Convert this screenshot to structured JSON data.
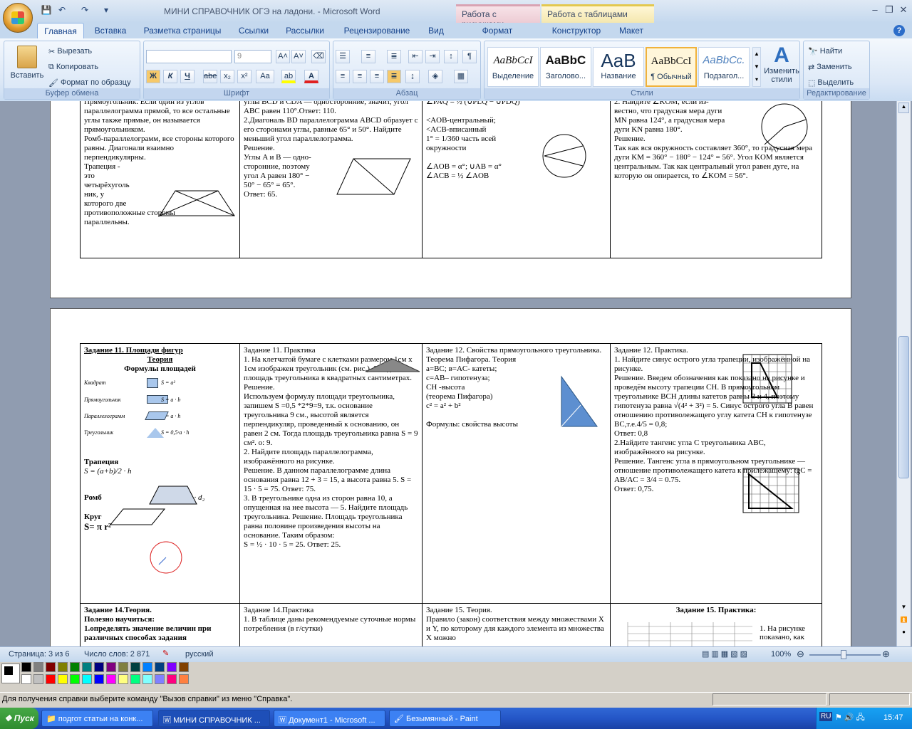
{
  "window": {
    "title": "МИНИ СПРАВОЧНИК ОГЭ на ладони. - Microsoft Word",
    "ctx_tab1": "Работа с рисунками",
    "ctx_tab2": "Работа с таблицами"
  },
  "tabs": [
    "Главная",
    "Вставка",
    "Разметка страницы",
    "Ссылки",
    "Рассылки",
    "Рецензирование",
    "Вид",
    "Формат",
    "Конструктор",
    "Макет"
  ],
  "clipboard": {
    "paste": "Вставить",
    "cut": "Вырезать",
    "copy": "Копировать",
    "format": "Формат по образцу",
    "label": "Буфер обмена"
  },
  "font": {
    "name": "",
    "size": "9",
    "label": "Шрифт",
    "b": "Ж",
    "i": "К",
    "u": "Ч",
    "strike": "abe",
    "sub": "x₂",
    "sup": "x²",
    "case": "Aa"
  },
  "paragraph": {
    "label": "Абзац"
  },
  "styles": {
    "label": "Стили",
    "change": "Изменить стили",
    "items": [
      {
        "sample": "AaBbCcI",
        "name": "Выделение"
      },
      {
        "sample": "AaBbC",
        "name": "Заголово..."
      },
      {
        "sample": "AaB",
        "name": "Название"
      },
      {
        "sample": "AaBbCcI",
        "name": "¶ Обычный"
      },
      {
        "sample": "AaBbCc.",
        "name": "Подзагол..."
      }
    ]
  },
  "editing": {
    "find": "Найти",
    "replace": "Заменить",
    "select": "Выделить",
    "label": "Редактирование"
  },
  "doc": {
    "p1": {
      "c1": "Прямоугольник. Если один из углов параллелограмма прямой, то все остальные углы также прямые, он называется прямоугольником.\nРомб-параллелограмм, все стороны которого равны. Диагонали взаимно перпендикулярны.\nТрапеция -\nэто\nчетырёхуголь\nник, у\nкоторого две\nпротивоположные стороны\nпараллельны.",
      "c2": "углы BCD и CDA — односторонние, значит, угол ABC равен 110°.Ответ: 110.\n2.Диагональ BD параллелограмма ABCD образует с его сторонами углы, равные 65° и 50°. Найдите меньший угол параллелограмма.\nРешение.\nУглы A и B — одно-\nсторонние, поэтому\nугол A равен 180° −\n50° − 65° = 65°.\nОтвет: 65.",
      "c3": "∠PAQ = ½ (∪PLQ − ∪PDQ)\n\n<AOB-центральный;\n<ACB-вписанный\n1° = 1/360 часть всей\nокружности\n\n∠AOB = α°; ∪AB = α°\n∠ACB = ½ ∠AOB",
      "c4": "2. Найдите ∠KOM, если из-\nвестно, что градусная мера дуги\nMN равна 124°, а градусная мера\nдуги KN равна 180°.\nРешение.\nТак как вся окружность составляет 360°, то градусная мера дуги KM = 360° − 180° − 124° = 56°. Угол KOM является центральным. Так как центральный угол равен дуге, на которую он опирается, то ∠KOM = 56°."
    },
    "p2": {
      "r1c1_head": "Задание 11. Площади фигур",
      "r1c1_sub": "Теория",
      "r1c1_sub2": "Формулы площадей",
      "shapes": [
        {
          "name": "Квадрат",
          "f": "S = a²"
        },
        {
          "name": "Прямоугольник",
          "f": "S = a · b"
        },
        {
          "name": "Параллелограмм",
          "f": "S = a · h"
        },
        {
          "name": "Треугольник",
          "f": "S = 0,5·a · h"
        }
      ],
      "trap": "Трапеция",
      "trap_f": "S = (a+b)/2 · h",
      "rhomb": "Ромб",
      "rhomb_f": "S = ½ · d₁ · d₂",
      "circle": "Круг",
      "circle_f": "S= π r²",
      "r1c2": "Задание 11. Практика\n1. На клетчатой бумаге с клетками размером 1см х 1см изображен треугольник (см. рис.). Найдите площадь треугольника в квадратных сантиметрах. Решение.\nИспользуем формулу площади треугольника, запишем S =0,5 *2*9=9, т.к. основание треугольника 9 см., высотой является перпендикуляр, проведенный к основанию, он равен 2 см. Тогда площадь треугольника равна S = 9 см². о: 9.\n2. Найдите площадь параллелограмма, изображённого на рисунке.\nРешение. В данном параллелограмме длина основания равна 12 + 3 = 15, а высота равна 5. S = 15 · 5 = 75. Ответ: 75.\n3. В треугольнике одна из сторон равна 10, а опущенная на нее высота — 5. Найдите площадь треугольника. Решение. Площадь треугольника равна половине произведения высоты на основание. Таким образом:\nS = ½ · 10 · 5 = 25. Ответ: 25.",
      "r1c3": "Задание 12. Свойства прямоугольного треугольника. Теорема Пифагора. Теория\na=BC; в=AC- катеты;\nc=AB– гипотенуза;\nCH -высота\n(теорема Пифагора)\nc² = a² + b²\n\nФормулы:          свойства высоты",
      "r1c4": "Задание 12. Практика.\n1. Найдите синус острого угла трапеции, изображённой на рисунке.\nРешение. Введем обозначения как показано на рисунке и проведём высоту трапеции CH. В прямоугольном треугольнике BCH длины катетов равны 3 и 4, поэтому гипотенуза равна √(4² + 3²) = 5. Синус острого угла B равен отношению противолежащего углу катета CH к гипотенузе BC,т.е.4/5 = 0,8;\nОтвет: 0,8\n2.Найдите тангенс угла C треугольника ABC, изображённого на рисунке.\nРешение. Тангенс угла в прямоугольном треугольнике — отношение противолежащего катета к прилежащему: tgC = AB/AC = 3/4 = 0.75.\nОтвет: 0,75.",
      "r2c1": "Задание 14.Теория.\nПолезно научиться:\n1.определять значение величин при различных способах задания",
      "r2c2": "Задание 14.Практика\n1. В таблице даны рекомендуемые суточные нормы потребления (в г/сутки)",
      "r2c3": "Задание 15. Теория.\nПравило (закон) соответствия между множествами X и Y, по которому для каждого элемента из множества X можно",
      "r2c4": "Задание 15. Практика:",
      "r2c4b": "1. На рисунке показано, как"
    }
  },
  "status": {
    "page": "Страница: 3 из 6",
    "words": "Число слов: 2 871",
    "lang": "русский",
    "zoom": "100%"
  },
  "paint": {
    "help": "Для получения справки выберите команду \"Вызов справки\" из меню \"Справка\".",
    "colors": [
      "#000000",
      "#808080",
      "#800000",
      "#808000",
      "#008000",
      "#008080",
      "#000080",
      "#800080",
      "#808040",
      "#004040",
      "#0080ff",
      "#004080",
      "#8000ff",
      "#804000",
      "#ffffff",
      "#c0c0c0",
      "#ff0000",
      "#ffff00",
      "#00ff00",
      "#00ffff",
      "#0000ff",
      "#ff00ff",
      "#ffff80",
      "#00ff80",
      "#80ffff",
      "#8080ff",
      "#ff0080",
      "#ff8040"
    ]
  },
  "taskbar": {
    "start": "Пуск",
    "tasks": [
      "подгот статьи на конк...",
      "МИНИ СПРАВОЧНИК ...",
      "Документ1 - Microsoft ...",
      "Безымянный - Paint"
    ],
    "lang": "RU",
    "time": "15:47"
  }
}
